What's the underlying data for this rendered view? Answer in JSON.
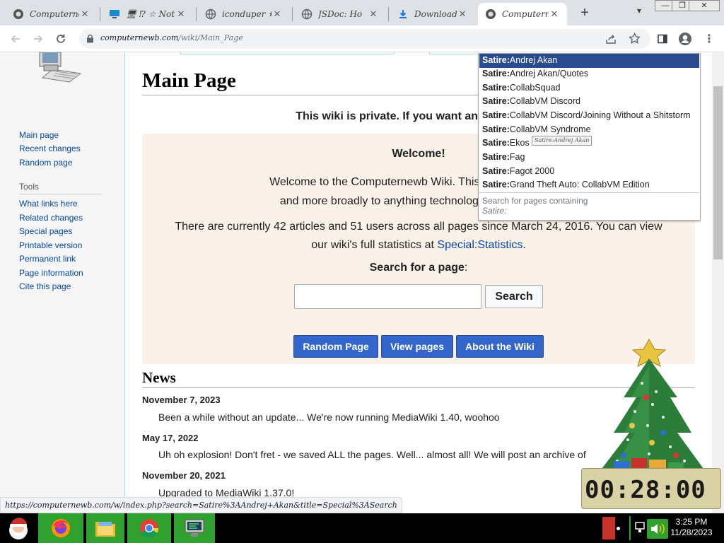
{
  "browser": {
    "tabs": [
      {
        "icon": "computernewb-icon",
        "label": "Computernewb",
        "active": false
      },
      {
        "icon": "monitor-icon",
        "label": "🖥 ⁉ ☆ Not",
        "active": false
      },
      {
        "icon": "globe-icon",
        "label": "iconduper ✸ ‹",
        "active": false
      },
      {
        "icon": "globe-icon",
        "label": "JSDoc: Ho",
        "active": false
      },
      {
        "icon": "download-icon",
        "label": "Downloads",
        "active": false
      },
      {
        "icon": "computernewb-icon",
        "label": "Computernewb",
        "active": true
      }
    ],
    "new_tab_label": "+",
    "url_host": "computernewb.com",
    "url_path": "/wiki/Main_Page",
    "status_url": "https://computernewb.com/w/index.php?search=Satire%3AAndrej+Akan&title=Special%3ASearch"
  },
  "sidebar": {
    "nav": [
      {
        "label": "Main page"
      },
      {
        "label": "Recent changes"
      },
      {
        "label": "Random page"
      }
    ],
    "tools_heading": "Tools",
    "tools": [
      {
        "label": "What links here"
      },
      {
        "label": "Related changes"
      },
      {
        "label": "Special pages"
      },
      {
        "label": "Printable version"
      },
      {
        "label": "Permanent link"
      },
      {
        "label": "Page information"
      },
      {
        "label": "Cite this page"
      }
    ]
  },
  "main": {
    "title": "Main Page",
    "private_note": "This wiki is private. If you want an account on",
    "welcome": {
      "heading": "Welcome!",
      "line1": "Welcome to the Computernewb Wiki. This Wiki is dedicated",
      "line2": "and more broadly to anything technology related. Regis",
      "stats_line1": "There are currently 42 articles and 51 users across all pages since March 24, 2016. You can view",
      "stats_line2_pre": "our wiki's full statistics at ",
      "stats_link": "Special:Statistics",
      "stats_line2_post": ".",
      "search_label": "Search for a page",
      "search_colon": ":",
      "search_button": "Search"
    },
    "buttons": [
      {
        "label": "Random Page"
      },
      {
        "label": "View pages"
      },
      {
        "label": "About the Wiki"
      }
    ],
    "news_heading": "News",
    "news": [
      {
        "date": "November 7, 2023",
        "text": "Been a while without an update... We're now running MediaWiki 1.40, woohoo"
      },
      {
        "date": "May 17, 2022",
        "text": "Uh oh explosion! Don't fret - we saved ALL the pages. Well... almost all! We will post an archive of"
      },
      {
        "date": "November 20, 2021",
        "text": "Upgraded to MediaWiki 1.37.0!"
      }
    ]
  },
  "suggestions": {
    "prefix": "Satire:",
    "items": [
      {
        "rest": "Andrej Akan",
        "selected": true
      },
      {
        "rest": "Andrej Akan/Quotes",
        "selected": false
      },
      {
        "rest": "CollabSquad",
        "selected": false
      },
      {
        "rest": "CollabVM Discord",
        "selected": false
      },
      {
        "rest": "CollabVM Discord/Joining Without a Shitstorm",
        "selected": false
      },
      {
        "rest": "CollabVM Syndrome",
        "selected": false
      },
      {
        "rest": "Ekos",
        "selected": false
      },
      {
        "rest": "Fag",
        "selected": false
      },
      {
        "rest": "Fagot 2000",
        "selected": false
      },
      {
        "rest": "Grand Theft Auto: CollabVM Edition",
        "selected": false
      }
    ],
    "tooltip": "Satire:Andrej Akan",
    "footer_label": "Search for pages containing",
    "footer_query": "Satire:"
  },
  "widget": {
    "clock": "00:28:00"
  },
  "taskbar": {
    "time": "3:25 PM",
    "date": "11/28/2023"
  },
  "colors": {
    "link": "#0645ad",
    "primary_button": "#3366cc",
    "suggest_selected": "#2a4b8d",
    "welcome_bg": "#faf2e8",
    "taskbar_item": "#2ea12e"
  }
}
